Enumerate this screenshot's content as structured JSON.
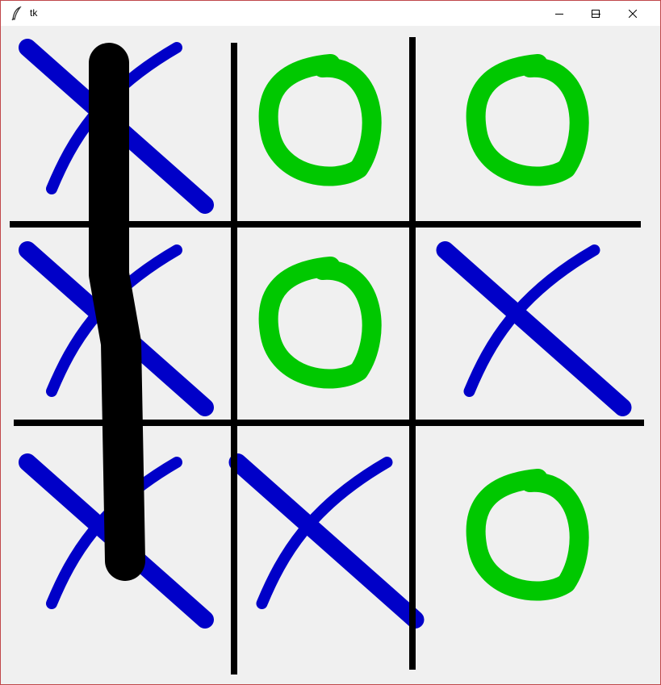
{
  "window": {
    "title": "tk",
    "icon": "tk-feather-icon",
    "controls": [
      "minimize-icon",
      "maximize-icon",
      "close-icon"
    ]
  },
  "board": {
    "cells": [
      [
        "X",
        "O",
        "O"
      ],
      [
        "X",
        "O",
        "X"
      ],
      [
        "X",
        "X",
        "O"
      ]
    ],
    "winning_line": "column-1",
    "colors": {
      "x": "#0000c8",
      "o": "#00c800",
      "grid": "#000000",
      "win_line": "#000000",
      "background": "#f0f0f0"
    }
  }
}
